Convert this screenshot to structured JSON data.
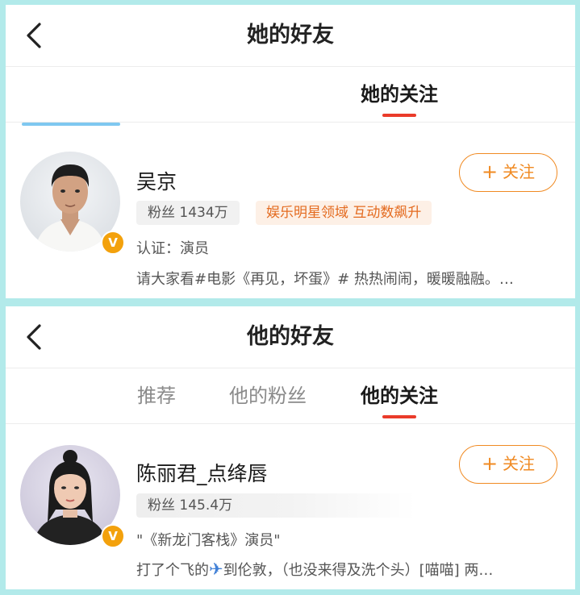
{
  "screens": [
    {
      "title": "她的好友",
      "tabs": [
        {
          "label": "她的关注",
          "active": true
        }
      ],
      "user": {
        "name": "吴京",
        "avatar": "avatar-man-white-shirt",
        "verified_mark": "V",
        "fans": "粉丝 1434万",
        "hot_tag": "娱乐明星领域 互动数飙升",
        "certification": "认证：演员",
        "desc": "请大家看#电影《再见，坏蛋》# 热热闹闹，暖暖融融。…",
        "follow_icon": "+",
        "follow_label": "关注"
      }
    },
    {
      "title": "他的好友",
      "tabs": [
        {
          "label": "推荐",
          "active": false
        },
        {
          "label": "他的粉丝",
          "active": false
        },
        {
          "label": "他的关注",
          "active": true
        }
      ],
      "user": {
        "name": "陈丽君_点绛唇",
        "avatar": "avatar-woman-hair-bun",
        "verified_mark": "V",
        "fans": "粉丝 145.4万",
        "certification": "\"《新龙门客栈》演员\"",
        "desc_before": "打了个飞的",
        "desc_emoji": "✈",
        "desc_after": "到伦敦，（也没来得及洗个头）[喵喵] 两…",
        "follow_icon": "+",
        "follow_label": "关注"
      }
    }
  ],
  "colors": {
    "accent_orange": "#f08a22",
    "tab_underline": "#ea3b2a",
    "hot_tag_text": "#e46b20",
    "verified": "#f3a10c",
    "frame": "#b2eaea"
  },
  "icons": {
    "back": "back-chevron-icon",
    "airplane": "airplane-emoji-icon"
  }
}
